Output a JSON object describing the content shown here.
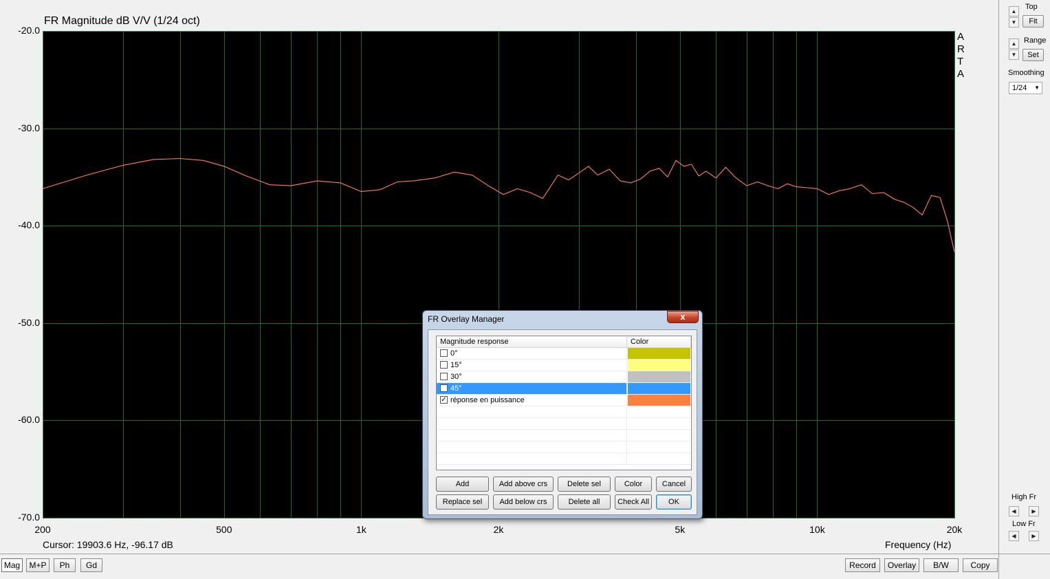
{
  "plot": {
    "title": "FR Magnitude dB V/V (1/24 oct)",
    "cursor_readout": "Cursor: 19903.6 Hz, -96.17 dB",
    "x_axis_label": "Frequency (Hz)",
    "arta_letters": [
      "A",
      "R",
      "T",
      "A"
    ],
    "colors": {
      "background": "#000000",
      "grid": "#1f6b2a",
      "curve": "#ff8060"
    }
  },
  "chart_data": {
    "type": "line",
    "title": "FR Magnitude dB V/V (1/24 oct)",
    "xlabel": "Frequency (Hz)",
    "ylabel": "",
    "xscale": "log",
    "xlim": [
      200,
      20000
    ],
    "ylim": [
      -70,
      -20
    ],
    "x_ticks": [
      200,
      500,
      1000,
      2000,
      5000,
      10000,
      20000
    ],
    "x_tick_labels": [
      "200",
      "500",
      "1k",
      "2k",
      "5k",
      "10k",
      "20k"
    ],
    "y_ticks": [
      -20,
      -30,
      -40,
      -50,
      -60,
      -70
    ],
    "y_tick_labels": [
      "-20.0",
      "-30.0",
      "-40.0",
      "-50.0",
      "-60.0",
      "-70.0"
    ],
    "grid": true,
    "series": [
      {
        "name": "réponse en puissance",
        "color": "#ff8060",
        "x": [
          200,
          250,
          300,
          350,
          400,
          450,
          500,
          560,
          630,
          700,
          800,
          900,
          1000,
          1100,
          1200,
          1300,
          1450,
          1600,
          1750,
          1900,
          2050,
          2200,
          2350,
          2500,
          2600,
          2700,
          2850,
          3000,
          3150,
          3300,
          3500,
          3700,
          3900,
          4100,
          4300,
          4500,
          4700,
          4900,
          5100,
          5300,
          5500,
          5700,
          6000,
          6300,
          6600,
          7000,
          7400,
          7800,
          8200,
          8600,
          9000,
          9500,
          10000,
          10600,
          11200,
          11800,
          12500,
          13200,
          14000,
          14800,
          15500,
          16200,
          17000,
          17800,
          18600,
          19300,
          20000
        ],
        "values": [
          -36.2,
          -34.8,
          -33.8,
          -33.2,
          -33.1,
          -33.3,
          -33.9,
          -34.9,
          -35.8,
          -35.9,
          -35.4,
          -35.6,
          -36.5,
          -36.3,
          -35.5,
          -35.4,
          -35.1,
          -34.5,
          -34.8,
          -35.9,
          -36.8,
          -36.2,
          -36.6,
          -37.2,
          -36.0,
          -34.8,
          -35.3,
          -34.6,
          -33.9,
          -34.8,
          -34.2,
          -35.4,
          -35.6,
          -35.2,
          -34.4,
          -34.1,
          -35.0,
          -33.3,
          -33.9,
          -33.7,
          -34.9,
          -34.4,
          -35.1,
          -34.0,
          -35.0,
          -35.9,
          -35.5,
          -35.9,
          -36.2,
          -35.7,
          -36.0,
          -36.1,
          -36.2,
          -36.8,
          -36.4,
          -36.2,
          -35.8,
          -36.7,
          -36.6,
          -37.3,
          -37.6,
          -38.1,
          -38.9,
          -36.9,
          -37.1,
          -39.5,
          -42.7
        ]
      }
    ]
  },
  "right_panel": {
    "top_label": "Top",
    "fit_button": "Fit",
    "range_label": "Range",
    "set_button": "Set",
    "smoothing_label": "Smoothing",
    "smoothing_value": "1/24",
    "high_fr_label": "High Fr",
    "low_fr_label": "Low Fr"
  },
  "toolbar_left": [
    "Mag",
    "M+P",
    "Ph",
    "Gd"
  ],
  "toolbar_right": [
    "Record",
    "Overlay",
    "B/W",
    "Copy"
  ],
  "dialog": {
    "title": "FR Overlay Manager",
    "close_glyph": "x",
    "columns": [
      "Magnitude response",
      "Color"
    ],
    "rows": [
      {
        "name": "0°",
        "checked": false,
        "color": "#c4c400",
        "selected": false
      },
      {
        "name": "15°",
        "checked": false,
        "color": "#ffff80",
        "selected": false
      },
      {
        "name": "30°",
        "checked": false,
        "color": "#c0c0c0",
        "selected": false
      },
      {
        "name": "45°",
        "checked": false,
        "color": "#3399ff",
        "selected": true
      },
      {
        "name": "réponse en puissance",
        "checked": true,
        "color": "#ff8040",
        "selected": false
      }
    ],
    "buttons_row1": [
      "Add",
      "Add above crs",
      "Delete sel",
      "Color",
      "Cancel"
    ],
    "buttons_row2": [
      "Replace sel",
      "Add below crs",
      "Delete all",
      "Check All",
      "OK"
    ]
  }
}
